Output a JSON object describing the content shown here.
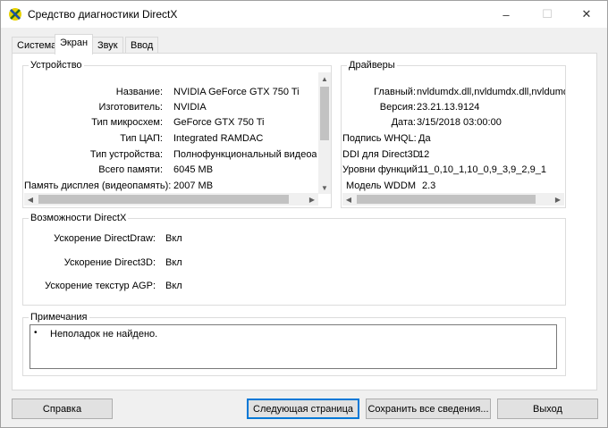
{
  "window": {
    "title": "Средство диагностики DirectX",
    "minimize": "–",
    "maximize": "☐",
    "close": "✕"
  },
  "tabs": [
    {
      "label": "Система",
      "active": false
    },
    {
      "label": "Экран",
      "active": true
    },
    {
      "label": "Звук",
      "active": false
    },
    {
      "label": "Ввод",
      "active": false
    }
  ],
  "device": {
    "title": "Устройство",
    "rows": [
      {
        "label": "Название:",
        "value": "NVIDIA GeForce GTX 750 Ti"
      },
      {
        "label": "Изготовитель:",
        "value": "NVIDIA"
      },
      {
        "label": "Тип микросхем:",
        "value": "GeForce GTX 750 Ti"
      },
      {
        "label": "Тип ЦАП:",
        "value": "Integrated RAMDAC"
      },
      {
        "label": "Тип устройства:",
        "value": "Полнофункциональный видеоадап"
      },
      {
        "label": "Всего памяти:",
        "value": "6045 MB"
      },
      {
        "label": "Память дисплея (видеопамять):",
        "value": "2007 MB"
      }
    ]
  },
  "drivers": {
    "title": "Драйверы",
    "rows": [
      {
        "label": "Главный:",
        "value": "nvldumdx.dll,nvldumdx.dll,nvldumdx.d"
      },
      {
        "label": "Версия:",
        "value": "23.21.13.9124"
      },
      {
        "label": "Дата:",
        "value": "3/15/2018 03:00:00"
      },
      {
        "label": "Подпись WHQL:",
        "value": "Да"
      },
      {
        "label": "DDI для Direct3D:",
        "value": "12"
      },
      {
        "label": "Уровни функций:",
        "value": "11_0,10_1,10_0,9_3,9_2,9_1"
      },
      {
        "label": "Модель WDDM",
        "value": "2.3"
      }
    ]
  },
  "features": {
    "title": "Возможности DirectX",
    "rows": [
      {
        "label": "Ускорение DirectDraw:",
        "value": "Вкл"
      },
      {
        "label": "Ускорение Direct3D:",
        "value": "Вкл"
      },
      {
        "label": "Ускорение текстур AGP:",
        "value": "Вкл"
      }
    ]
  },
  "notes": {
    "title": "Примечания",
    "bullet": "•",
    "text": "Неполадок не найдено."
  },
  "buttons": {
    "help": "Справка",
    "next": "Следующая страница",
    "save": "Сохранить все сведения...",
    "exit": "Выход"
  },
  "icons": {
    "app": "directx-icon",
    "scroll_up": "▲",
    "scroll_down": "▼",
    "scroll_left": "◀",
    "scroll_right": "▶"
  }
}
